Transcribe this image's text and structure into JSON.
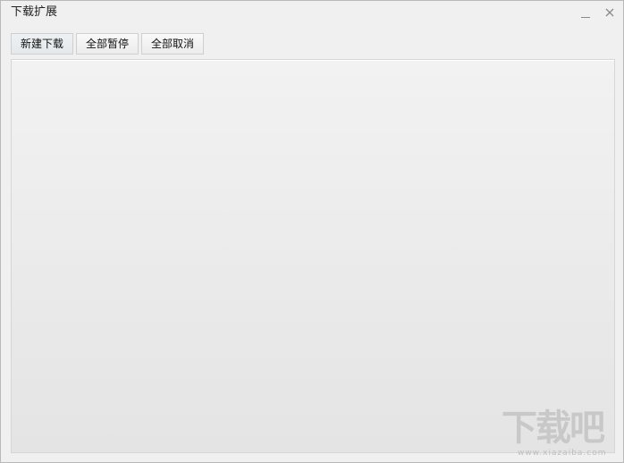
{
  "window": {
    "title": "下载扩展"
  },
  "toolbar": {
    "new_download": "新建下载",
    "pause_all": "全部暂停",
    "cancel_all": "全部取消"
  },
  "watermark": {
    "main": "下载吧",
    "sub": "www.xiazaiba.com"
  }
}
